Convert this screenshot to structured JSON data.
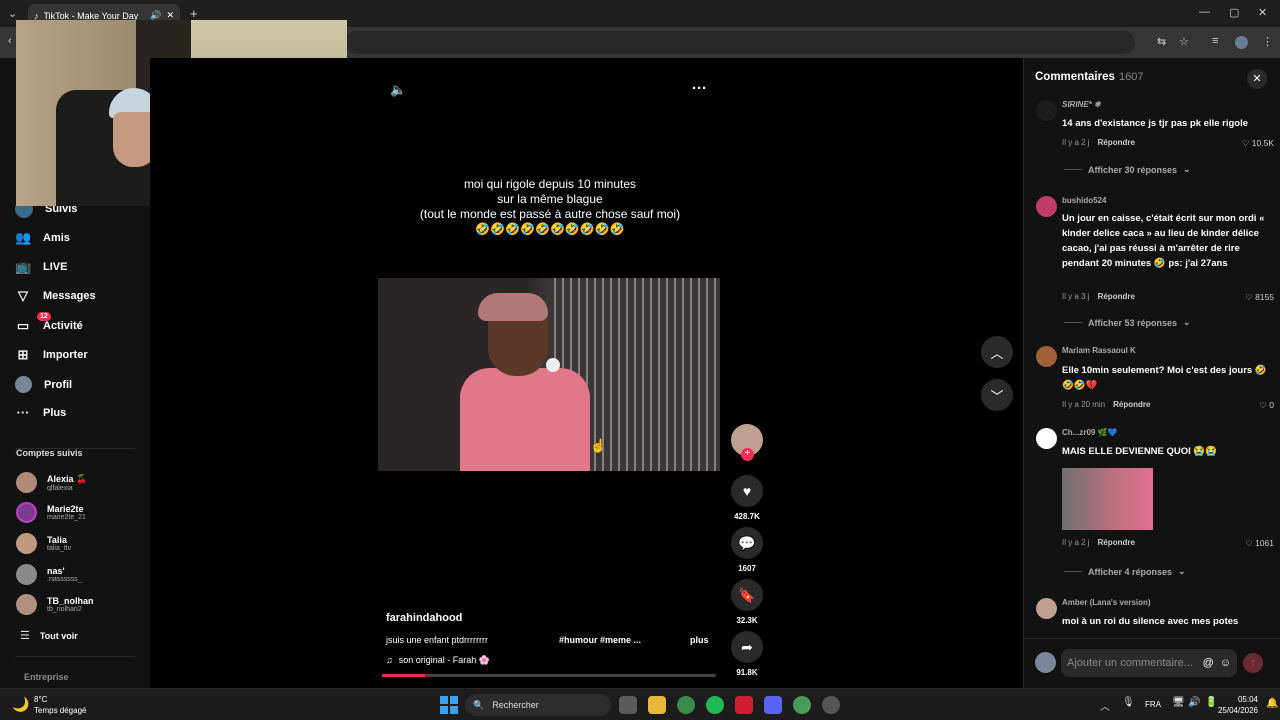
{
  "browser": {
    "tab_title": "TikTok - Make Your Day",
    "new_tab_label": "+",
    "tab_close": "✕",
    "win_minimize": "—",
    "win_maximize": "▢",
    "win_close": "✕"
  },
  "sidebar": {
    "items": [
      {
        "label": "Suivis",
        "icon": "people-icon"
      },
      {
        "label": "Amis",
        "icon": "friends-icon"
      },
      {
        "label": "LIVE",
        "icon": "live-icon"
      },
      {
        "label": "Messages",
        "icon": "messages-icon"
      },
      {
        "label": "Activité",
        "icon": "activity-icon",
        "badge": "12"
      },
      {
        "label": "Importer",
        "icon": "upload-icon"
      },
      {
        "label": "Profil",
        "icon": "profile-icon"
      },
      {
        "label": "Plus",
        "icon": "more-icon"
      }
    ],
    "following_title": "Comptes suivis",
    "accounts": [
      {
        "name": "Alexia 🍒",
        "handle": "qlfalexia"
      },
      {
        "name": "Marie2te",
        "handle": "marie2te_21"
      },
      {
        "name": "Talia",
        "handle": "talia_ttv"
      },
      {
        "name": "nas'",
        "handle": ".nassssss_"
      },
      {
        "name": "TB_nolhan",
        "handle": "tb_nolhan2"
      }
    ],
    "see_all": "Tout voir",
    "footer": "Entreprise"
  },
  "video": {
    "overlay_text": [
      "moi qui rigole depuis 10 minutes",
      "sur la même blague",
      "(tout le monde est passé à autre chose sauf moi)",
      "🤣🤣🤣🤣🤣🤣🤣🤣🤣🤣"
    ],
    "author": "farahindahood",
    "description": "jsuis une enfant ptdrrrrrrrr",
    "hashtags": "#humour #meme ...",
    "more_label": "plus",
    "sound": "son original - Farah 🌸",
    "progress_fraction": 0.13,
    "actions": {
      "likes": "428.7K",
      "comments": "1607",
      "saves": "32.3K",
      "shares": "91.8K"
    }
  },
  "comments_panel": {
    "title": "Commentaires",
    "count": "1607",
    "reply_label": "Répondre",
    "input_placeholder": "Ajouter un commentaire...",
    "items": [
      {
        "user": "SIRINE* ❄",
        "text": "14 ans d'existance js tjr pas pk elle rigole",
        "time": "Il y a 2 j",
        "likes": "10.5K",
        "replies": "Afficher 30 réponses"
      },
      {
        "user": "bushido524",
        "text": "Un jour en caisse, c'était écrit sur mon ordi « kinder delice caca » au lieu de kinder délice cacao, j'ai pas réussi à m'arrêter de rire pendant 20 minutes 🤣 ps: j'ai 27ans",
        "time": "Il y a 3 j",
        "likes": "8155",
        "replies": "Afficher 53 réponses"
      },
      {
        "user": "Mariam Rassaoul K",
        "text": "Elle 10min seulement? Moi c'est des jours 🤣🤣🤣💔",
        "time": "Il y a 20 min",
        "likes": "0"
      },
      {
        "user": "Ch...zr09 🌿💙",
        "text": "MAIS ELLE DEVIENNE QUOI 😭😭",
        "time": "Il y a 2 j",
        "likes": "1061",
        "replies": "Afficher 4 réponses"
      },
      {
        "user": "Amber (Lana's version)",
        "text": "moi à un roi du silence avec mes potes",
        "time": "",
        "likes": ""
      }
    ]
  },
  "taskbar": {
    "weather_temp": "8°C",
    "weather_desc": "Temps dégagé",
    "search_label": "Rechercher",
    "lang": "FRA",
    "time": "05:04",
    "date": "25/04/2026"
  }
}
